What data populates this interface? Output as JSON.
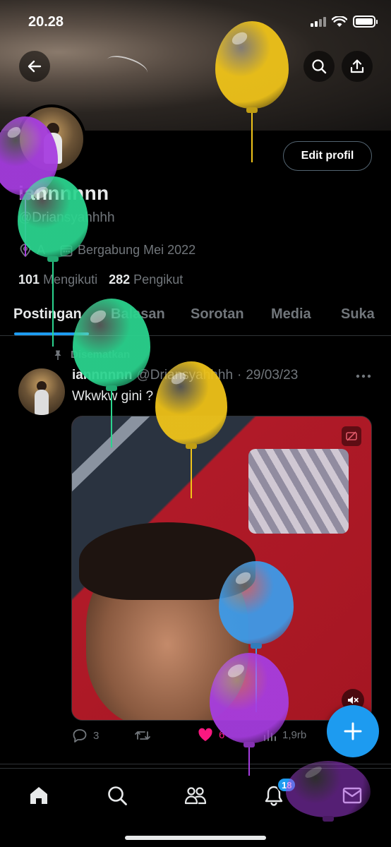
{
  "status_bar": {
    "time": "20.28"
  },
  "profile": {
    "edit_button": "Edit profil",
    "display_name": "iannnnnn",
    "handle": "@Driansyahhhh",
    "location": "A",
    "joined": "Bergabung Mei 2022",
    "following_count": "101",
    "following_label": "Mengikuti",
    "followers_count": "282",
    "followers_label": "Pengikut"
  },
  "tabs": [
    {
      "label": "Postingan",
      "active": true
    },
    {
      "label": "Balasan",
      "active": false
    },
    {
      "label": "Sorotan",
      "active": false
    },
    {
      "label": "Media",
      "active": false
    },
    {
      "label": "Suka",
      "active": false
    }
  ],
  "post": {
    "pinned_label": "Disematkan",
    "author_name": "iannnnnn",
    "author_handle": "@Driansyahhhh",
    "separator": "·",
    "date": "29/03/23",
    "text": "Wkwkw gini ?",
    "replies": "3",
    "likes": "6",
    "views": "1,9rb"
  },
  "nav": {
    "notifications_badge": "18"
  },
  "colors": {
    "accent": "#1d9bf0",
    "like": "#f91880",
    "balloon_yellow": "#f0c419",
    "balloon_purple": "#a63de0",
    "balloon_green": "#2bd48e",
    "balloon_blue": "#3d9be9"
  },
  "icons": [
    "back-arrow-icon",
    "search-icon",
    "share-icon",
    "location-icon",
    "calendar-icon",
    "pin-icon",
    "more-icon",
    "reply-icon",
    "retweet-icon",
    "heart-icon",
    "views-icon",
    "mute-icon",
    "plus-icon",
    "home-icon",
    "communities-icon",
    "bell-icon",
    "mail-icon"
  ]
}
